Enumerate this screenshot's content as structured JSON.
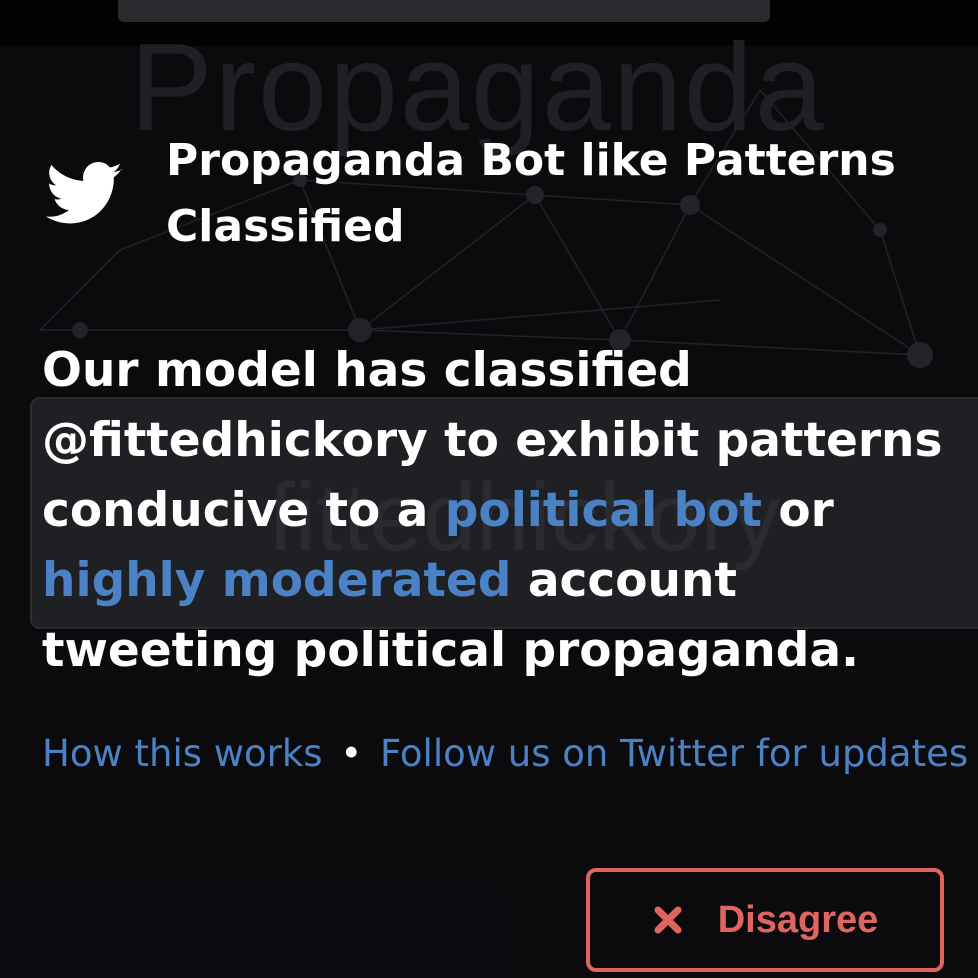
{
  "background": {
    "watermark_title": "Propaganda",
    "watermark_handle": "fittedhickory"
  },
  "header": {
    "icon": "twitter-icon",
    "title": "Propaganda Bot like Patterns Classified"
  },
  "message": {
    "part1": "Our model has classified @fittedhickory to exhibit patterns conducive to a ",
    "link1": "political bot",
    "part2": " or ",
    "link2": "highly moderated",
    "part3": " account tweeting political propaganda."
  },
  "links": {
    "how_it_works": "How this works",
    "separator": "•",
    "follow": "Follow us on Twitter for updates"
  },
  "actions": {
    "disagree_label": "Disagree",
    "disagree_icon": "close-icon"
  },
  "colors": {
    "link": "#4b82c5",
    "danger": "#e06560",
    "text": "#ffffff",
    "background": "#0c0d10"
  }
}
